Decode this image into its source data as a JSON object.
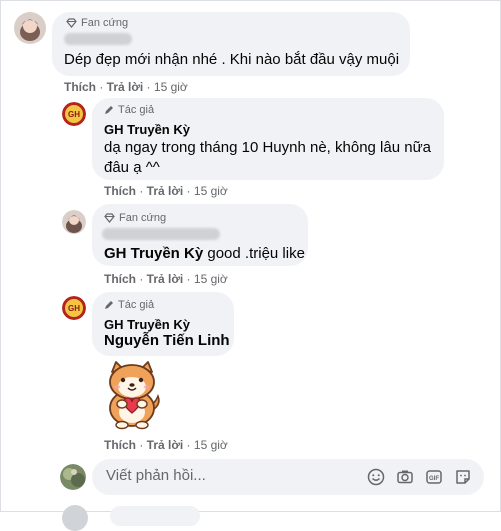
{
  "comments": [
    {
      "badge": "Fan cứng",
      "text": "Dép đẹp mới nhận nhé . Khi nào bắt đầu vậy muội",
      "actions": {
        "like": "Thích",
        "reply": "Trả lời",
        "time": "15 giờ"
      }
    },
    {
      "badge": "Tác giả",
      "author": "GH Truyền Kỳ",
      "text_line1": "dạ ngay trong tháng 10 Huynh nè, không lâu nữa",
      "text_line2": "đâu ạ ^^",
      "actions": {
        "like": "Thích",
        "reply": "Trả lời",
        "time": "15 giờ"
      }
    },
    {
      "badge": "Fan cứng",
      "mention": "GH Truyền Kỳ",
      "text": " good .triệu like",
      "actions": {
        "like": "Thích",
        "reply": "Trả lời",
        "time": "15 giờ"
      }
    },
    {
      "badge": "Tác giả",
      "author": "GH Truyền Kỳ",
      "mention": "Nguyễn Tiến Linh",
      "sticker": "shiba-heart-sticker",
      "actions": {
        "like": "Thích",
        "reply": "Trả lời",
        "time": "15 giờ"
      }
    }
  ],
  "reply_box": {
    "placeholder": "Viết phản hồi...",
    "icons": [
      "emoji-icon",
      "camera-icon",
      "gif-icon",
      "sticker-icon"
    ]
  },
  "colors": {
    "bubble": "#f0f2f5",
    "meta": "#65676b",
    "text": "#050505",
    "brand_red": "#c0392b"
  }
}
